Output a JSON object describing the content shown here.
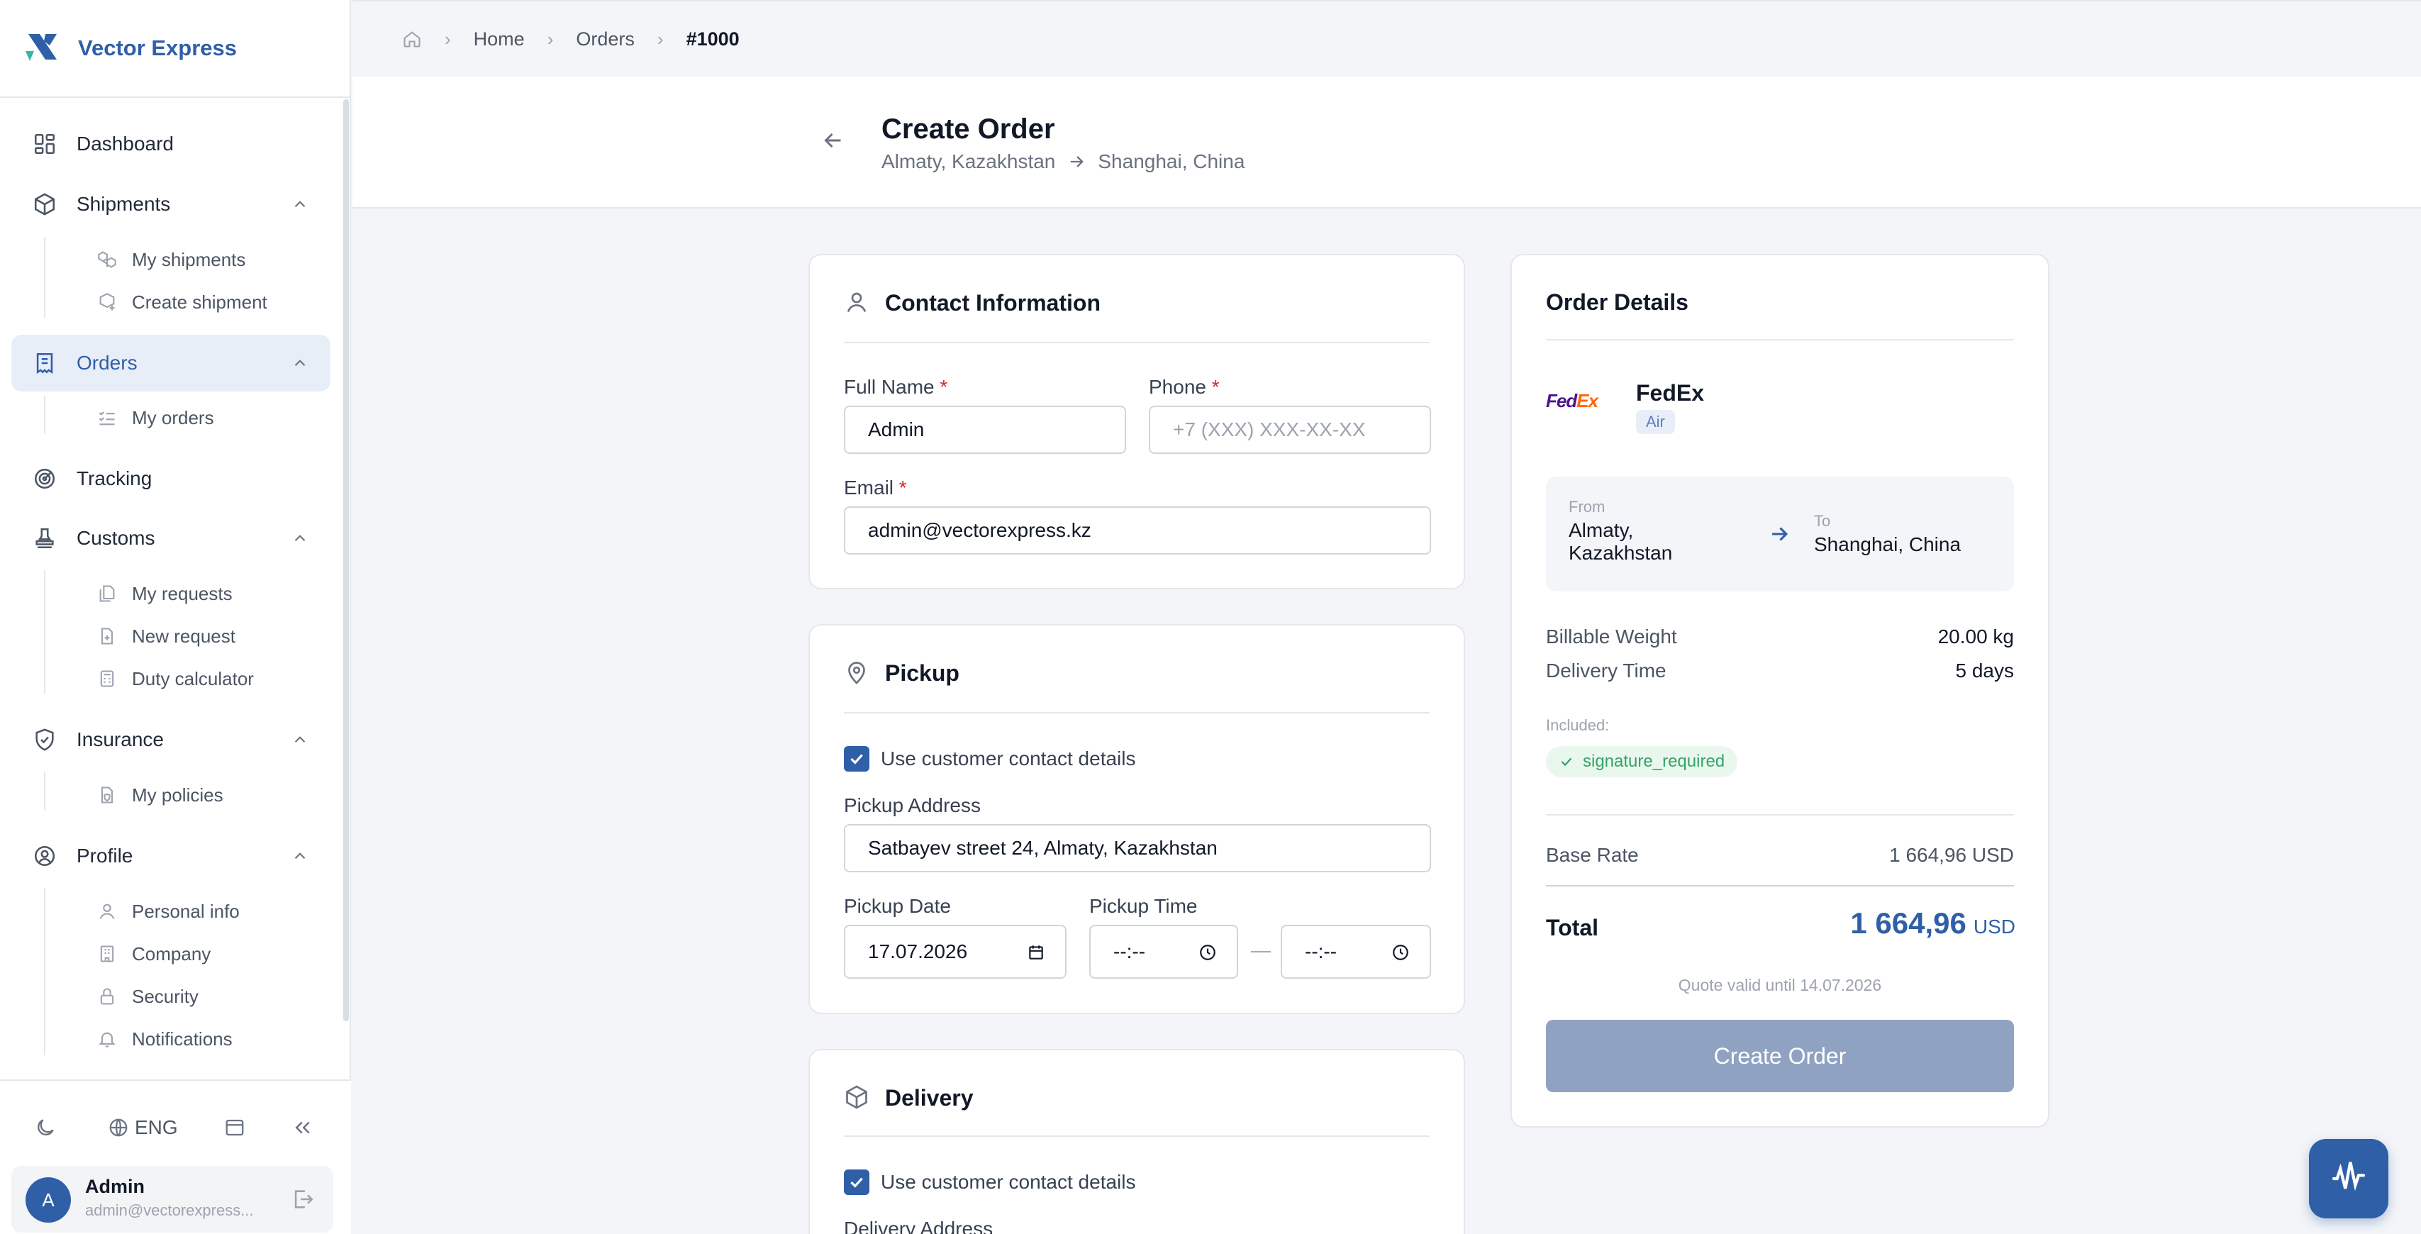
{
  "app": {
    "name": "Vector Express"
  },
  "sidebar": {
    "items": [
      {
        "label": "Dashboard"
      },
      {
        "label": "Shipments",
        "children": [
          "My shipments",
          "Create shipment"
        ]
      },
      {
        "label": "Orders",
        "children": [
          "My orders"
        ],
        "active": true
      },
      {
        "label": "Tracking"
      },
      {
        "label": "Customs",
        "children": [
          "My requests",
          "New request",
          "Duty calculator"
        ]
      },
      {
        "label": "Insurance",
        "children": [
          "My policies"
        ]
      },
      {
        "label": "Profile",
        "children": [
          "Personal info",
          "Company",
          "Security",
          "Notifications"
        ]
      }
    ],
    "language": "ENG",
    "user": {
      "name": "Admin",
      "email": "admin@vectorexpress...",
      "initial": "A"
    }
  },
  "breadcrumb": {
    "home": "Home",
    "orders": "Orders",
    "current": "#1000"
  },
  "header": {
    "title": "Create Order",
    "from": "Almaty, Kazakhstan",
    "to": "Shanghai, China"
  },
  "contact": {
    "title": "Contact Information",
    "full_name_label": "Full Name",
    "full_name_value": "Admin",
    "phone_label": "Phone",
    "phone_placeholder": "+7 (XXX) XXX-XX-XX",
    "email_label": "Email",
    "email_value": "admin@vectorexpress.kz",
    "required_mark": "*"
  },
  "pickup": {
    "title": "Pickup",
    "use_contact_label": "Use customer contact details",
    "address_label": "Pickup Address",
    "address_value": "Satbayev street 24, Almaty, Kazakhstan",
    "date_label": "Pickup Date",
    "date_value": "17.07.2026",
    "time_label": "Pickup Time",
    "time_from": "--:--",
    "time_to": "--:--",
    "time_sep": "—"
  },
  "delivery": {
    "title": "Delivery",
    "use_contact_label": "Use customer contact details",
    "address_label": "Delivery Address"
  },
  "order_details": {
    "title": "Order Details",
    "carrier_logo_text": "FedEx",
    "carrier": "FedEx",
    "mode": "Air",
    "from_label": "From",
    "from_value": "Almaty, Kazakhstan",
    "to_label": "To",
    "to_value": "Shanghai, China",
    "billable_weight_label": "Billable Weight",
    "billable_weight_value": "20.00 kg",
    "delivery_time_label": "Delivery Time",
    "delivery_time_value": "5 days",
    "included_label": "Included:",
    "included_items": [
      "signature_required"
    ],
    "base_rate_label": "Base Rate",
    "base_rate_value": "1 664,96 USD",
    "total_label": "Total",
    "total_value": "1 664,96",
    "total_currency": "USD",
    "valid_until": "Quote valid until 14.07.2026",
    "create_button": "Create Order"
  },
  "colors": {
    "accent": "#2f5fa7",
    "disabled_button": "#8fa2c2",
    "success": "#34a366",
    "danger": "#dc2626"
  }
}
